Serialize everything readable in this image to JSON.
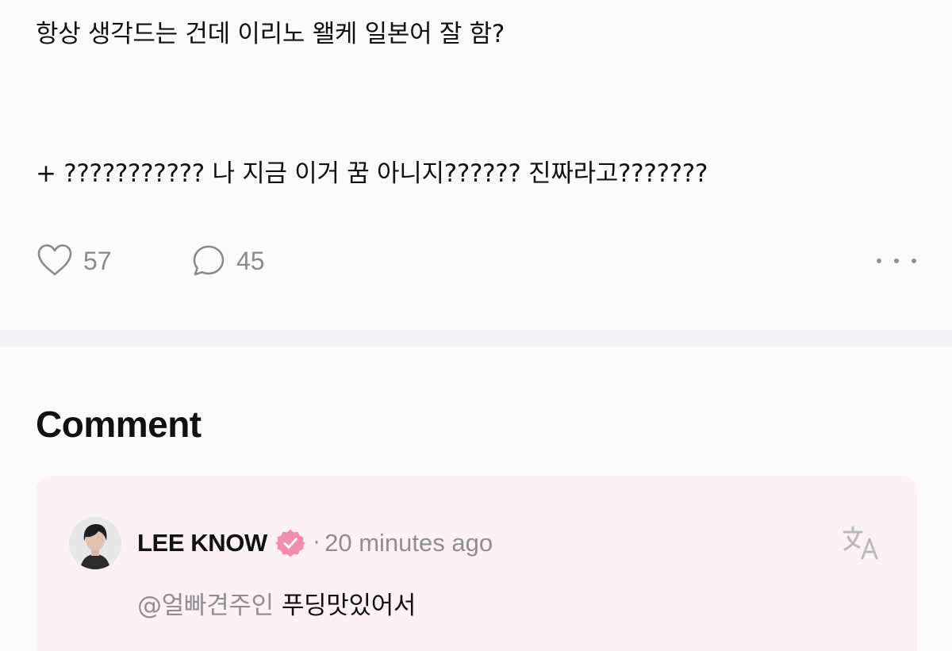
{
  "post": {
    "line1": "항상 생각드는 건데 이리노 왤케 일본어 잘 함?",
    "line2": "+ ??????????? 나 지금 이거 꿈 아니지?????? 진짜라고???????"
  },
  "actions": {
    "like_icon": "heart-outline-icon",
    "like_count": "57",
    "comment_icon": "speech-bubble-icon",
    "comment_count": "45",
    "more_icon": "more-horizontal-icon"
  },
  "comments": {
    "heading": "Comment",
    "items": [
      {
        "author": "LEE KNOW",
        "verified": true,
        "verified_icon": "verified-badge-icon",
        "separator": "·",
        "time": "20 minutes ago",
        "translate_icon": "translate-icon",
        "mention": "@얼빠견주인",
        "text": "푸딩맛있어서"
      }
    ]
  },
  "colors": {
    "text_primary": "#111111",
    "text_secondary": "#8e8e93",
    "background": "#fcfbfc",
    "divider": "#f3f2f4",
    "comment_card": "#fcf1f4",
    "verified_badge": "#f48cb0"
  }
}
